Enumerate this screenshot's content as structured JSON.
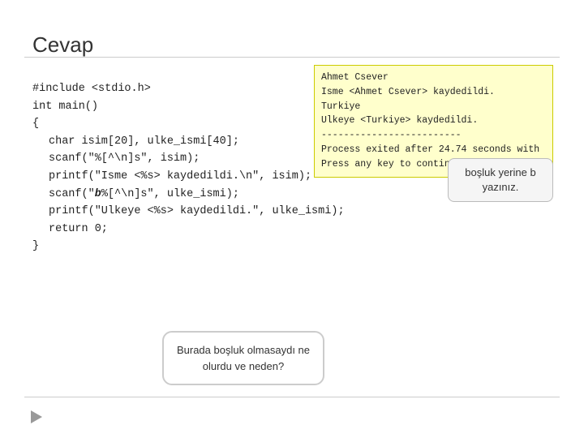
{
  "slide": {
    "title": "Cevap",
    "code": {
      "line1": "#include <stdio.h>",
      "line2": "int main()",
      "line3": "{",
      "line4": "    char isim[20], ulke_ismi[40];",
      "line5": "    scanf(\"%[^\\n]s\", isim);",
      "line6": "    printf(\"Isme <%s> kaydedildi.\\n\", isim);",
      "line7": "    scanf(\"b%[^\\n]s\", ulke_ismi);",
      "line8": "    printf(\"Ulkeye <%s> kaydedildi.\", ulke_ismi);",
      "line9": "    return 0;",
      "line10": "}"
    },
    "terminal": {
      "line1": "Ahmet Csever",
      "line2": "Isme <Ahmet Csever> kaydedildi.",
      "line3": "Turkiye",
      "line4": "Ulkeye <Turkiye> kaydedildi.",
      "line5": "-------------------------",
      "line6": "Process exited after 24.74 seconds with",
      "line7": "Press any key to continue . . ."
    },
    "tooltip": {
      "text": "boşluk yerine b yazınız."
    },
    "callout": {
      "text": "Burada boşluk olmasaydı ne olurdu ve neden?"
    }
  }
}
